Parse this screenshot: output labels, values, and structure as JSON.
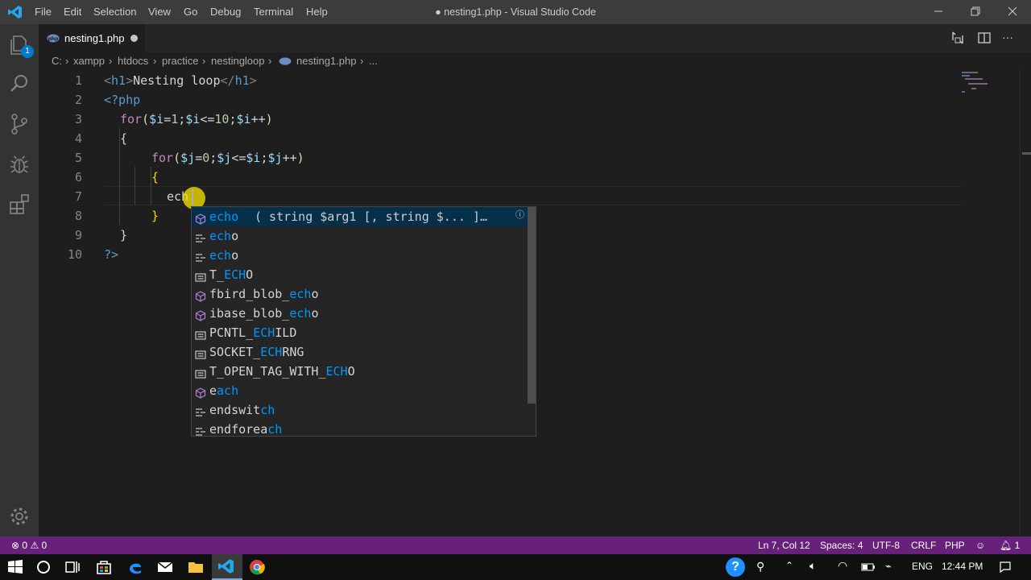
{
  "app": {
    "window_title": "● nesting1.php - Visual Studio Code",
    "menu": [
      "File",
      "Edit",
      "Selection",
      "View",
      "Go",
      "Debug",
      "Terminal",
      "Help"
    ],
    "colors": {
      "status_bar": "#68217a",
      "editor_bg": "#1e1e1e",
      "accent": "#0097fb"
    }
  },
  "activity_bar": {
    "items": [
      {
        "icon": "explorer-icon",
        "badge": "1"
      },
      {
        "icon": "search-icon"
      },
      {
        "icon": "source-control-icon"
      },
      {
        "icon": "debug-icon"
      },
      {
        "icon": "extensions-icon"
      }
    ],
    "bottom_icon": "gear-icon"
  },
  "tab": {
    "label": "nesting1.php",
    "modified": true
  },
  "breadcrumb": {
    "parts": [
      "C:",
      "xampp",
      "htdocs",
      "practice",
      "nestingloop",
      "nesting1.php",
      "..."
    ]
  },
  "editor": {
    "line_numbers": [
      "1",
      "2",
      "3",
      "4",
      "5",
      "6",
      "7",
      "8",
      "9",
      "10"
    ],
    "lines": [
      "<h1>Nesting loop</h1>",
      "<?php",
      "for($i=1;$i<=10;$i++)",
      "{",
      "for($j=0;$j<=$i;$j++)",
      "{",
      "ech",
      "}",
      "}",
      "?>"
    ]
  },
  "suggest": {
    "items": [
      {
        "icon": "method-icon",
        "match": "echo",
        "rest": "",
        "detail": "( string $arg1 [, string $... ]…",
        "selected": true
      },
      {
        "icon": "snippet-icon",
        "match": "ech",
        "rest": "o"
      },
      {
        "icon": "snippet-icon",
        "match": "ech",
        "rest": "o"
      },
      {
        "icon": "constant-icon",
        "pre": "T_",
        "match": "ECH",
        "rest": "O"
      },
      {
        "icon": "method-icon",
        "pre": "fbird_blob_",
        "match": "ech",
        "rest": "o"
      },
      {
        "icon": "method-icon",
        "pre": "ibase_blob_",
        "match": "ech",
        "rest": "o"
      },
      {
        "icon": "constant-icon",
        "pre": "PCNTL_",
        "match": "ECH",
        "rest": "ILD"
      },
      {
        "icon": "constant-icon",
        "pre": "SOCKET_",
        "match": "ECH",
        "rest": "RNG"
      },
      {
        "icon": "constant-icon",
        "pre": "T_OPEN_TAG_WITH_",
        "match": "ECH",
        "rest": "O"
      },
      {
        "icon": "method-icon",
        "pre": "e",
        "match": "ach",
        "rest": ""
      },
      {
        "icon": "snippet-icon",
        "pre": "endswit",
        "match": "ch",
        "rest": ""
      },
      {
        "icon": "snippet-icon",
        "pre": "endforea",
        "match": "ch",
        "rest": ""
      }
    ]
  },
  "status_bar": {
    "errors": "0",
    "warnings": "0",
    "position": "Ln 7, Col 12",
    "spaces": "Spaces: 4",
    "encoding": "UTF-8",
    "eol": "CRLF",
    "language": "PHP",
    "notifications": "1"
  },
  "taskbar": {
    "language": "ENG",
    "time": "12:44 PM"
  }
}
